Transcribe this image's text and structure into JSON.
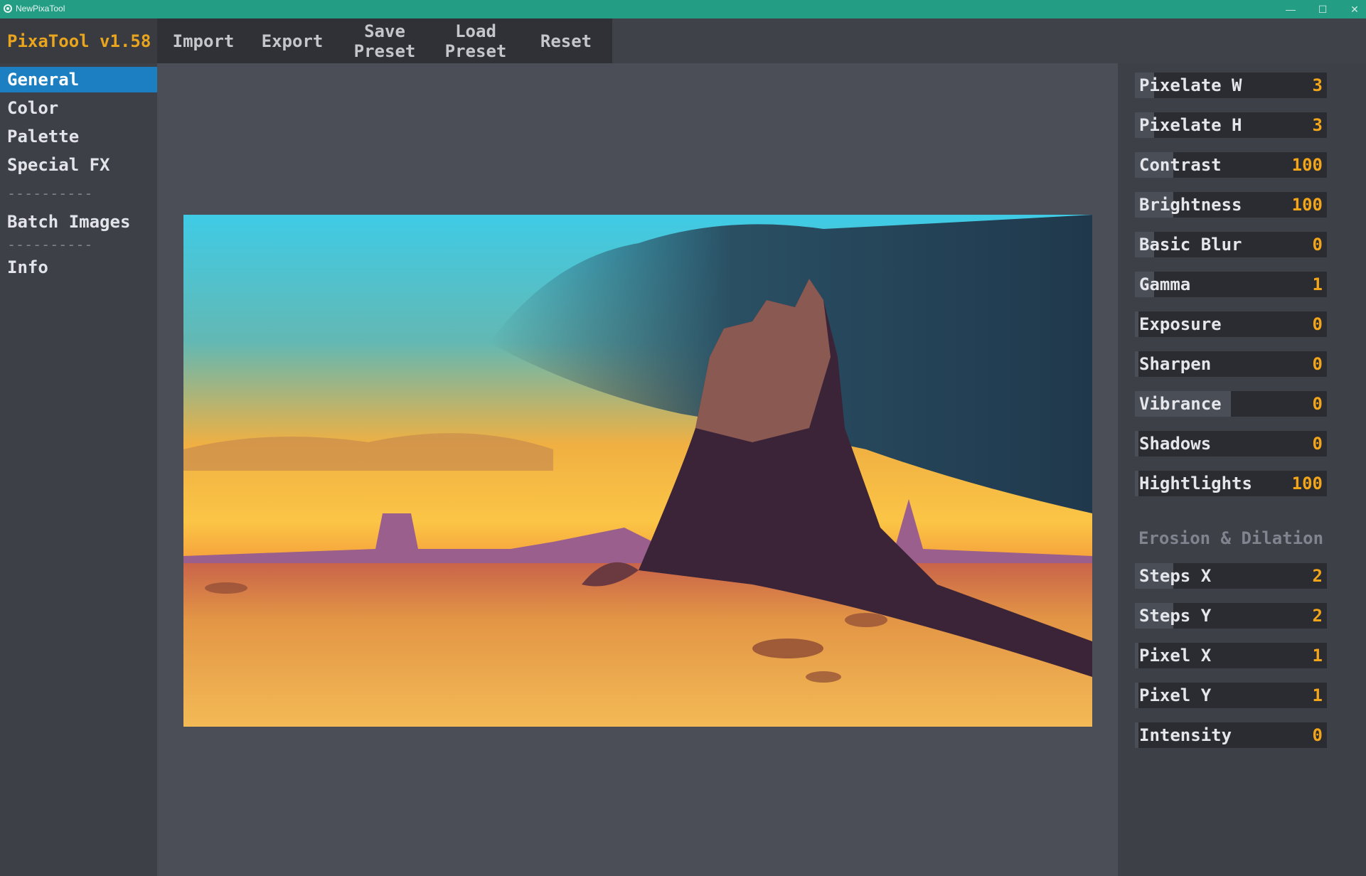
{
  "window": {
    "title": "NewPixaTool",
    "minimize": "—",
    "maximize": "☐",
    "close": "✕"
  },
  "brand": {
    "name": "PixaTool v1.58"
  },
  "toolbar": {
    "import": "Import",
    "export": "Export",
    "save_preset": [
      "Save",
      "Preset"
    ],
    "load_preset": [
      "Load",
      "Preset"
    ],
    "reset": "Reset"
  },
  "sidebar": {
    "items": [
      {
        "label": "General",
        "active": true
      },
      {
        "label": "Color"
      },
      {
        "label": "Palette"
      },
      {
        "label": "Special FX"
      },
      {
        "label": "----------"
      },
      {
        "label": "Batch Images"
      },
      {
        "label": "----------"
      },
      {
        "label": "Info"
      }
    ]
  },
  "sliders": [
    {
      "label": "Pixelate W",
      "value": "3",
      "fill": 0.1
    },
    {
      "label": "Pixelate H",
      "value": "3",
      "fill": 0.1
    },
    {
      "label": "Contrast",
      "value": "100",
      "fill": 0.2
    },
    {
      "label": "Brightness",
      "value": "100",
      "fill": 0.2
    },
    {
      "label": "Basic Blur",
      "value": "0",
      "fill": 0.1
    },
    {
      "label": "Gamma",
      "value": "1",
      "fill": 0.1
    },
    {
      "label": "Exposure",
      "value": "0",
      "fill": 0.02
    },
    {
      "label": "Sharpen",
      "value": "0",
      "fill": 0.02
    },
    {
      "label": "Vibrance",
      "value": "0",
      "fill": 0.5
    },
    {
      "label": "Shadows",
      "value": "0",
      "fill": 0.02
    },
    {
      "label": "Hightlights",
      "value": "100",
      "fill": 0.02
    }
  ],
  "erosion": {
    "title": "Erosion & Dilation",
    "sliders": [
      {
        "label": "Steps X",
        "value": "2",
        "fill": 0.2
      },
      {
        "label": "Steps Y",
        "value": "2",
        "fill": 0.2
      },
      {
        "label": "Pixel X",
        "value": "1",
        "fill": 0.02
      },
      {
        "label": "Pixel Y",
        "value": "1",
        "fill": 0.02
      },
      {
        "label": "Intensity",
        "value": "0",
        "fill": 0.02
      }
    ]
  },
  "colors": {
    "accent": "#1b7fc2",
    "brand": "#e9a51d",
    "value": "#f2a51a",
    "titlebar": "#239e85"
  }
}
